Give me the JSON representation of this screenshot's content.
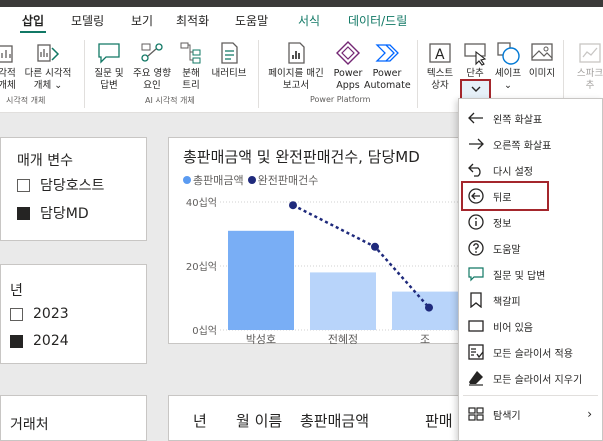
{
  "tabs": [
    {
      "label": "삽입",
      "active": true
    },
    {
      "label": "모델링"
    },
    {
      "label": "보기"
    },
    {
      "label": "최적화"
    },
    {
      "label": "도움말"
    },
    {
      "label": "서식",
      "color": "green"
    },
    {
      "label": "데이터/드릴",
      "color": "green"
    }
  ],
  "ribbon": {
    "buttons": [
      {
        "id": "visual-partial",
        "line1": "각적",
        "line2": "개체",
        "icon": "visual-icon"
      },
      {
        "id": "other-visual",
        "line1": "다른 시각적",
        "line2": "개체 ⌄",
        "icon": "visual-more-icon"
      },
      {
        "id": "qa",
        "line1": "질문 및",
        "line2": "답변",
        "icon": "qa-icon"
      },
      {
        "id": "key-influencers",
        "line1": "주요 영향",
        "line2": "요인",
        "icon": "key-influencers-icon"
      },
      {
        "id": "decomposition-tree",
        "line1": "분해",
        "line2": "트리",
        "icon": "decomposition-tree-icon"
      },
      {
        "id": "narrative",
        "line1": "내러티브",
        "line2": "",
        "icon": "narrative-icon"
      },
      {
        "id": "paginated-report",
        "line1": "페이지를 매긴",
        "line2": "보고서",
        "icon": "paginated-report-icon"
      },
      {
        "id": "power-apps",
        "line1": "Power",
        "line2": "Apps",
        "icon": "power-apps-icon"
      },
      {
        "id": "power-automate",
        "line1": "Power",
        "line2": "Automate",
        "icon": "power-automate-icon"
      },
      {
        "id": "text-box",
        "line1": "텍스트",
        "line2": "상자",
        "icon": "text-box-icon"
      },
      {
        "id": "buttons",
        "line1": "단추",
        "line2": "",
        "icon": "button-icon"
      },
      {
        "id": "shapes",
        "line1": "셰이프",
        "line2": "⌄",
        "icon": "shapes-icon"
      },
      {
        "id": "image",
        "line1": "이미지",
        "line2": "",
        "icon": "image-icon"
      },
      {
        "id": "sparkline",
        "line1": "스파크",
        "line2": "추",
        "icon": "sparkline-icon"
      }
    ],
    "groups": [
      {
        "label": "시각적 개체"
      },
      {
        "label": "AI 시각적 개체"
      },
      {
        "label": "Power Platform"
      }
    ]
  },
  "slicer_media": {
    "title": "매개 변수",
    "items": [
      {
        "label": "담당호스트",
        "checked": false
      },
      {
        "label": "담당MD",
        "checked": true
      }
    ]
  },
  "slicer_year": {
    "title": "년",
    "items": [
      {
        "label": "2023",
        "checked": false
      },
      {
        "label": "2024",
        "checked": true
      }
    ]
  },
  "slicer_partner": {
    "title": "거래처"
  },
  "chart": {
    "title": "총판매금액 및 완전판매건수, 담당MD",
    "legend": [
      {
        "name": "총판매금액",
        "color": "#5b9bf1"
      },
      {
        "name": "완전판매건수",
        "color": "#1f2a7c"
      }
    ]
  },
  "chart_data": {
    "type": "bar",
    "title": "총판매금액 및 완전판매건수, 담당MD",
    "categories": [
      "박성호",
      "전혜정",
      "조"
    ],
    "y_ticks": [
      "40십억",
      "20십억",
      "0십억"
    ],
    "ylim": [
      0,
      40
    ],
    "series": [
      {
        "name": "총판매금액",
        "type": "bar",
        "values": [
          31,
          18,
          12
        ],
        "colors": [
          "#79aef5",
          "#b8d4fa",
          "#b8d4fa"
        ]
      },
      {
        "name": "완전판매건수",
        "type": "line",
        "style": "dashed",
        "values": [
          39,
          26,
          7
        ]
      }
    ],
    "grid": true,
    "legend_position": "top-left"
  },
  "table": {
    "headers": [
      "년",
      "월 이름",
      "총판매금액",
      "판매"
    ]
  },
  "context_menu": {
    "items": [
      {
        "label": "왼쪽 화살표",
        "icon": "arrow-left-icon"
      },
      {
        "label": "오른쪽 화살표",
        "icon": "arrow-right-icon"
      },
      {
        "label": "다시 설정",
        "icon": "reset-icon"
      },
      {
        "label": "뒤로",
        "icon": "back-circle-icon",
        "highlighted": true
      },
      {
        "label": "정보",
        "icon": "info-icon"
      },
      {
        "label": "도움말",
        "icon": "help-icon"
      },
      {
        "label": "질문 및 답변",
        "icon": "qa-chat-icon"
      },
      {
        "label": "책갈피",
        "icon": "bookmark-icon"
      },
      {
        "label": "비어 있음",
        "icon": "blank-icon"
      },
      {
        "label": "모든 슬라이서 적용",
        "icon": "apply-slicers-icon"
      },
      {
        "label": "모든 슬라이서 지우기",
        "icon": "clear-slicers-icon"
      },
      {
        "label": "탐색기",
        "icon": "navigator-icon",
        "has_submenu": true
      }
    ]
  },
  "colors": {
    "accent_green": "#117865",
    "highlight_red": "#a4262c",
    "bar_primary": "#79aef5",
    "bar_secondary": "#b8d4fa",
    "line_series": "#1f2a7c"
  }
}
